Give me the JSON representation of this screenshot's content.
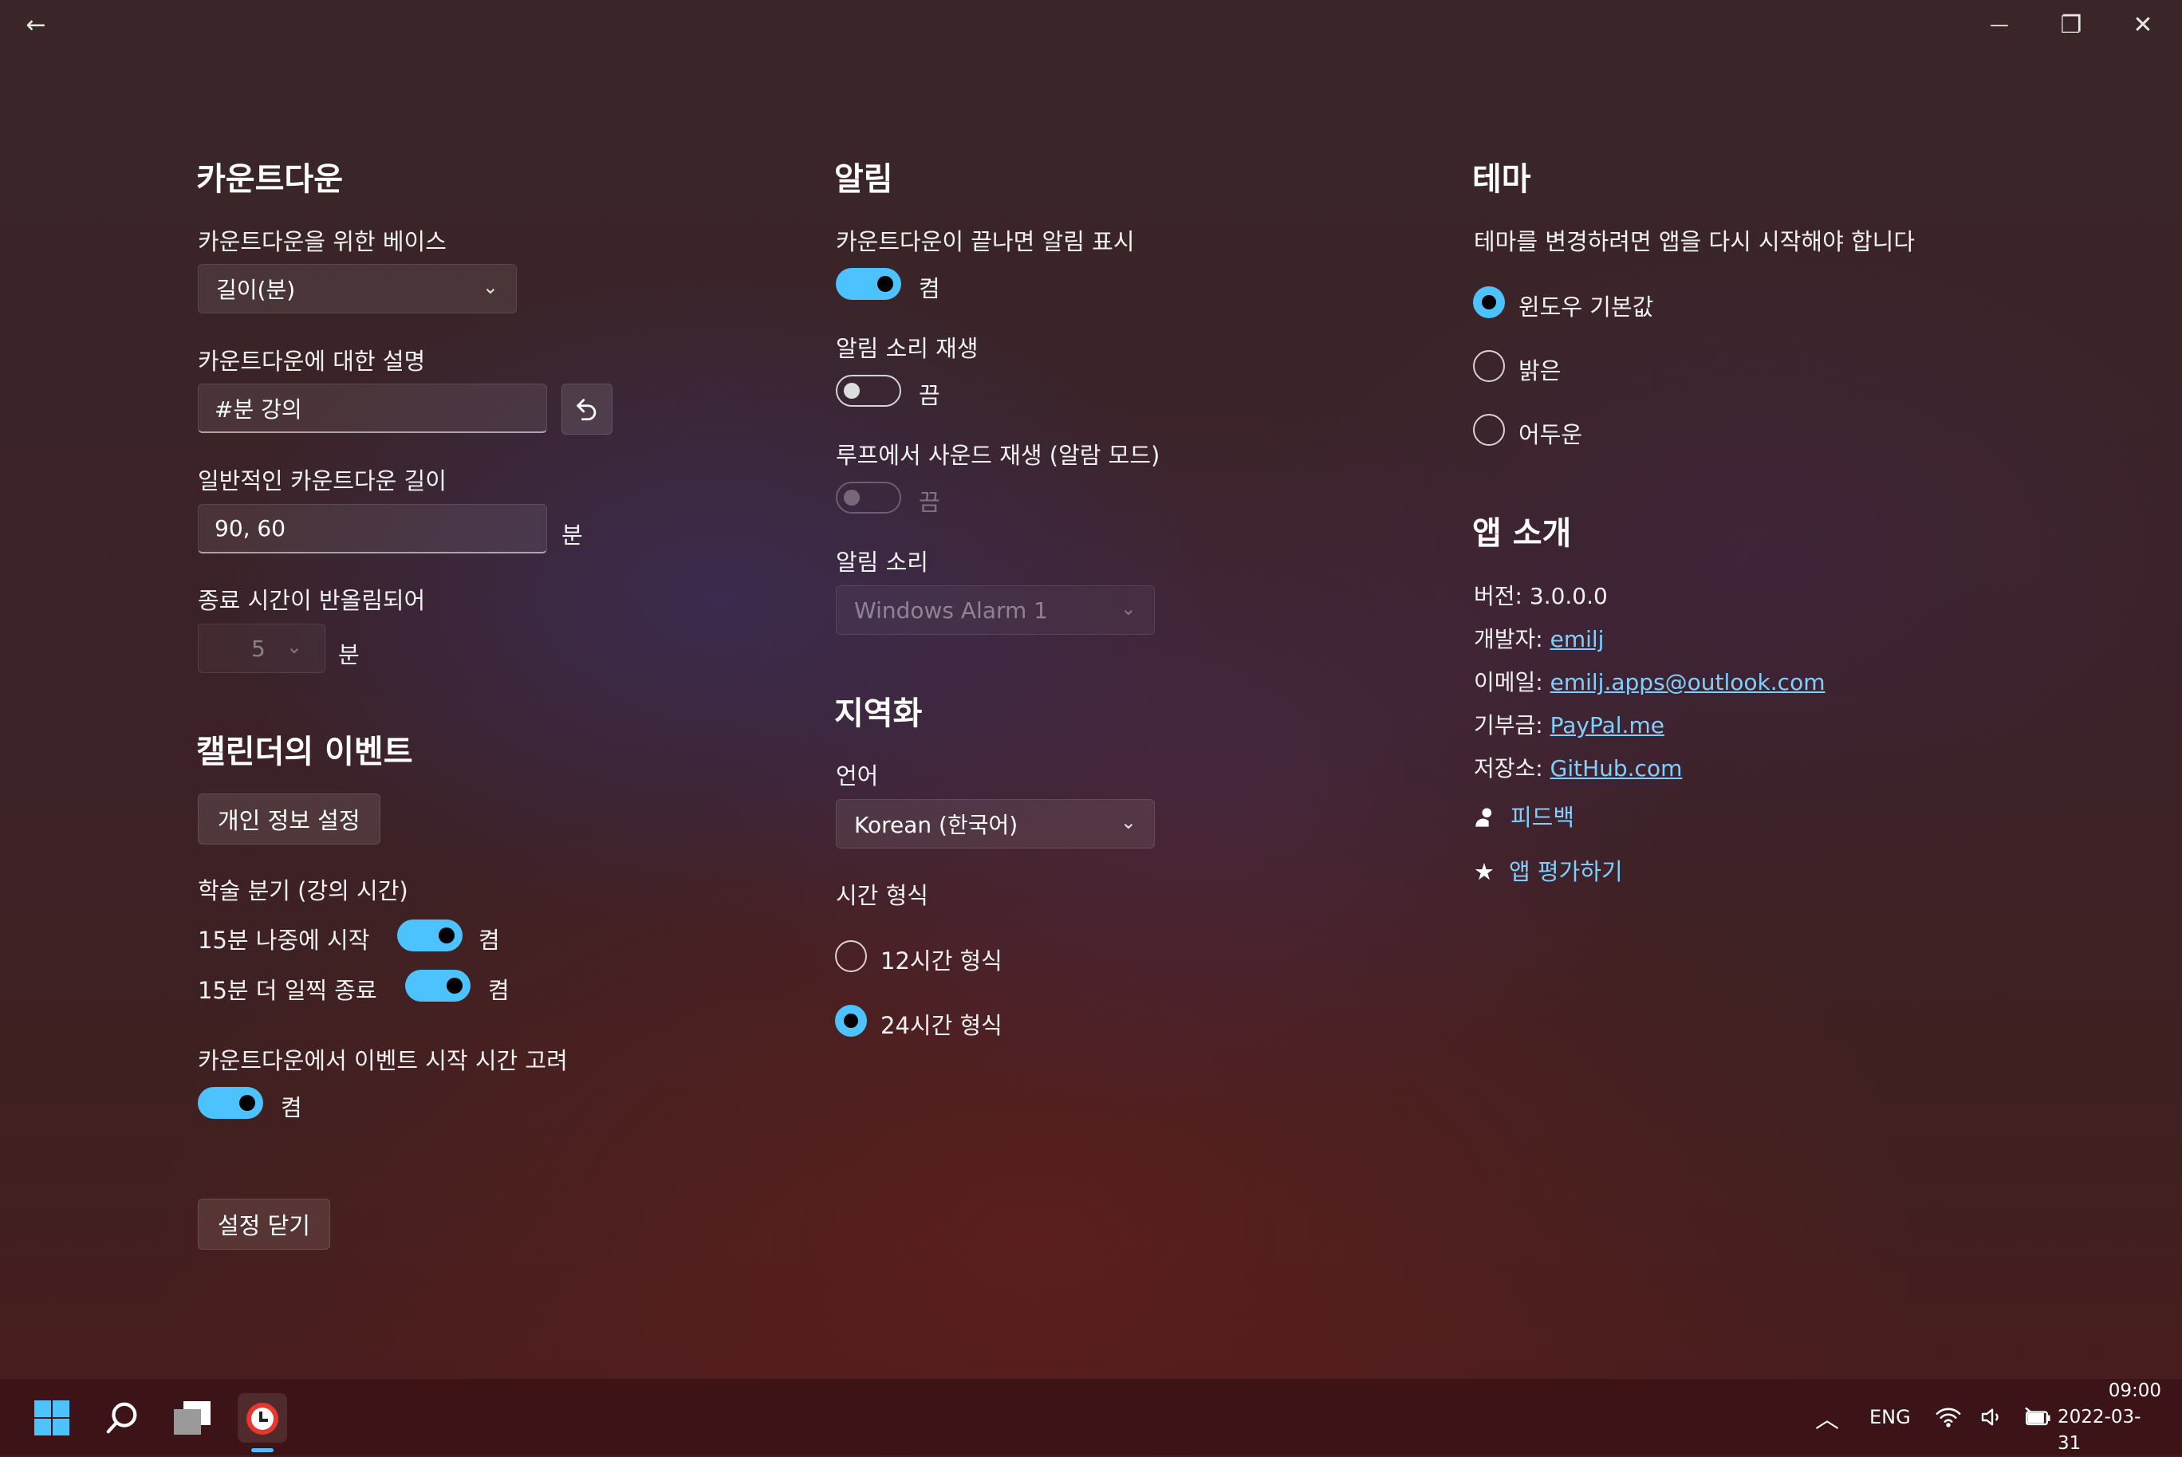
{
  "titlebar": {
    "back": "←",
    "minimize": "—",
    "restore": "❐",
    "close": "✕"
  },
  "countdown": {
    "heading": "카운트다운",
    "base_label": "카운트다운을 위한 베이스",
    "base_value": "길이(분)",
    "desc_label": "카운트다운에 대한 설명",
    "desc_value": "#분 강의",
    "length_label": "일반적인 카운트다운 길이",
    "length_value": "90, 60",
    "length_unit": "분",
    "round_label": "종료 시간이 반올림되어",
    "round_value": "5",
    "round_unit": "분"
  },
  "calendar": {
    "heading": "캘린더의 이벤트",
    "privacy_button": "개인 정보 설정",
    "academic_label": "학술 분기 (강의 시간)",
    "start_later_label": "15분 나중에 시작",
    "start_later_state": "켬",
    "end_earlier_label": "15분 더 일찍 종료",
    "end_earlier_state": "켬",
    "consider_start_label": "카운트다운에서 이벤트 시작 시간 고려",
    "consider_start_state": "켬",
    "close_button": "설정 닫기"
  },
  "notifications": {
    "heading": "알림",
    "show_label": "카운트다운이 끝나면 알림 표시",
    "show_state": "켬",
    "sound_label": "알림 소리 재생",
    "sound_state": "끔",
    "loop_label": "루프에서 사운드 재생 (알람 모드)",
    "loop_state": "끔",
    "sound_choice_label": "알림 소리",
    "sound_choice_value": "Windows Alarm 1"
  },
  "localization": {
    "heading": "지역화",
    "language_label": "언어",
    "language_value": "Korean (한국어)",
    "time_format_label": "시간 형식",
    "format_12": "12시간 형식",
    "format_24": "24시간 형식"
  },
  "theme": {
    "heading": "테마",
    "note": "테마를 변경하려면 앱을 다시 시작해야 합니다",
    "option_default": "윈도우 기본값",
    "option_light": "밝은",
    "option_dark": "어두운"
  },
  "about": {
    "heading": "앱 소개",
    "version_label": "버전:",
    "version_value": "3.0.0.0",
    "developer_label": "개발자:",
    "developer_value": "emilj",
    "email_label": "이메일:",
    "email_value": "emilj.apps@outlook.com",
    "donate_label": "기부금:",
    "donate_value": "PayPal.me",
    "repo_label": "저장소:",
    "repo_value": "GitHub.com",
    "feedback": "피드백",
    "rate": "앱 평가하기"
  },
  "taskbar": {
    "lang": "ENG",
    "time": "09:00",
    "date": "2022-03-31",
    "accent": "#4cc2ff"
  }
}
